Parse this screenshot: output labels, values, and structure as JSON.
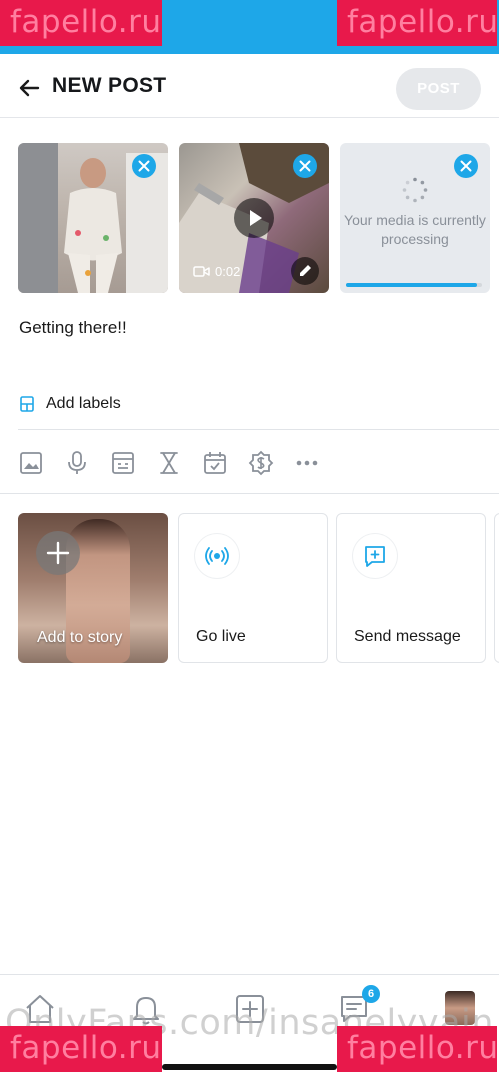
{
  "watermarks": {
    "top_left": "fapello.ru",
    "top_right": "fapello.ru",
    "bottom_left": "fapello.ru",
    "bottom_right": "fapello.ru",
    "footer": "OnlyFans.com/insanelyvain"
  },
  "header": {
    "title": "NEW POST",
    "post_button": "POST"
  },
  "media": {
    "video_duration": "0:02",
    "processing_text": "Your media is currently processing",
    "processing_progress": 0.96
  },
  "caption": "Getting there!!",
  "labels": {
    "label": "Add labels"
  },
  "toolbar": {
    "icons": [
      "image-icon",
      "microphone-icon",
      "poll-icon",
      "hourglass-icon",
      "calendar-icon",
      "dollar-badge-icon",
      "more-icon"
    ]
  },
  "cards": {
    "story": "Add to story",
    "live": "Go live",
    "message": "Send message"
  },
  "bottom_nav": {
    "messages_badge": "6"
  },
  "colors": {
    "accent": "#1ea7e8",
    "post_button_disabled": "#e6e8eb",
    "watermark": "#e8194b"
  }
}
